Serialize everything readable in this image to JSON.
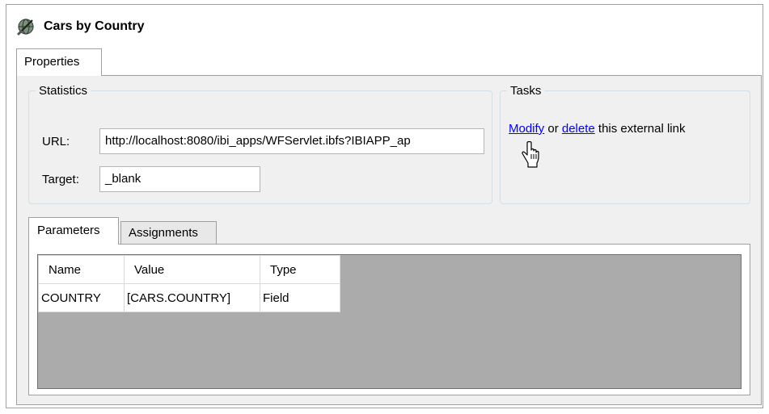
{
  "window": {
    "title": "Cars by Country",
    "icon": "globe-link-icon"
  },
  "tabs": {
    "properties": "Properties"
  },
  "statistics": {
    "legend": "Statistics",
    "url_label": "URL:",
    "url_value": "http://localhost:8080/ibi_apps/WFServlet.ibfs?IBIAPP_ap",
    "target_label": "Target:",
    "target_value": "_blank"
  },
  "tasks": {
    "legend": "Tasks",
    "modify_link": "Modify",
    "or_text": "or",
    "delete_link": "delete",
    "tail_text": "this external link"
  },
  "subtabs": {
    "parameters": "Parameters",
    "assignments": "Assignments"
  },
  "grid": {
    "columns": [
      "Name",
      "Value",
      "Type"
    ],
    "rows": [
      [
        "COUNTRY",
        "[CARS.COUNTRY]",
        "Field"
      ]
    ]
  },
  "colors": {
    "link": "#0000ff",
    "grid_background": "#ababab"
  }
}
